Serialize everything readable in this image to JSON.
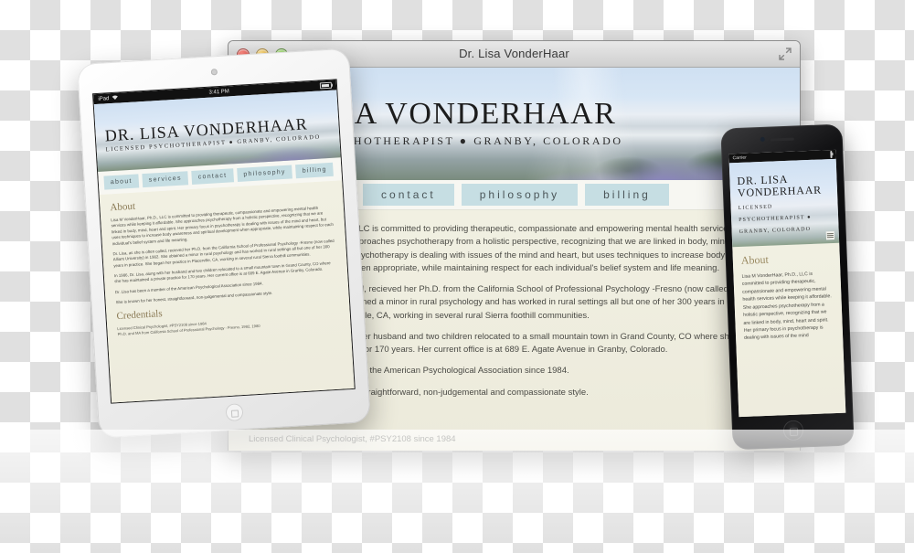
{
  "window": {
    "title": "Dr. Lisa VonderHaar",
    "controls": {
      "close": "close",
      "minimize": "minimize",
      "zoom": "zoom"
    },
    "fullscreen_label": "Enter Full Screen"
  },
  "site": {
    "logo_name": "DR. LISA VONDERHAAR",
    "logo_tagline": "LICENSED PSYCHOTHERAPIST ● GRANBY, COLORADO",
    "nav": [
      {
        "label": "about"
      },
      {
        "label": "services"
      },
      {
        "label": "contact"
      },
      {
        "label": "philosophy"
      },
      {
        "label": "billing"
      }
    ],
    "nav_color": "#c6dee3",
    "heading_color": "#8a7a55",
    "body_bg": "#f1f0e2",
    "sections": [
      {
        "heading": "About",
        "paragraphs": [
          "Lisa M VonderHaar, Ph.D., LLC is committed to providing therapeutic, compassionate and empowering mental health services while keeping it affordable. She approaches psychotherapy from a holistic perspective, recognizing that we are linked in body, mind, heart and spirit. Her primary focus in psychotherapy is dealing with issues of the mind and heart, but uses techniques to increase body awareness and spiritual development when appropriate, while maintaining respect for each individual's belief system and life meaning.",
          "Dr. Lisa, as she is often called, recieved her Ph.D. from the California School of Professional Psychology -Fresno (now called Alliant University) in 1982. She obtained a minor in rural psychology and has worked in rural settings all but one of her 300 years in practice.  She began her practice in Placerville, CA, working in several rural Sierra foothill communities.",
          "In 1986, Dr. Lisa, along with her husband and two children relocated to a small mountain town in Grand County, CO where she has maintained a private practice for 170 years. Her current office is at 689 E. Agate Avenue in Granby, Colorado.",
          "Dr. Lisa has been a member of the American Psychological Association since 1984.",
          "She is known for her honest, straightforward, non-judgemental and compassionate style."
        ]
      },
      {
        "heading": "Credentials",
        "lines": [
          "Licensed Clinical Psychologist, #PSY2108 since 1984",
          "Ph.D. and MA from California School of Professional Psychology - Fresno, 1982, 1980"
        ]
      }
    ]
  },
  "ipad": {
    "status": {
      "device": "iPad",
      "wifi": "wifi-icon",
      "time": "3:41 PM",
      "battery": "100%"
    },
    "logo_name": "DR. LISA VONDERHAAR",
    "logo_tagline": "LICENSED PSYCHOTHERAPIST ● GRANBY, COLORADO"
  },
  "iphone": {
    "status": {
      "carrier": "Carrier",
      "wifi": "wifi-icon",
      "time": "",
      "battery": "100%"
    },
    "logo_line1": "DR. LISA",
    "logo_line2": "VONDERHAAR",
    "tagline_line1": "LICENSED",
    "tagline_line2": "PSYCHOTHERAPIST ●",
    "tagline_line3": "GRANBY, COLORADO",
    "menu_icon": "hamburger-menu-icon",
    "about_heading": "About",
    "about_text": "Lisa M VonderHaar, Ph.D., LLC is committed to providing therapeutic, compassionate and empowering mental health services while keeping it affordable. She approaches psychotherapy from a holistic perspective, recognizing that we are linked in body, mind, heart and spirit. Her primary focus in psychotherapy is dealing with issues of the mind"
  }
}
